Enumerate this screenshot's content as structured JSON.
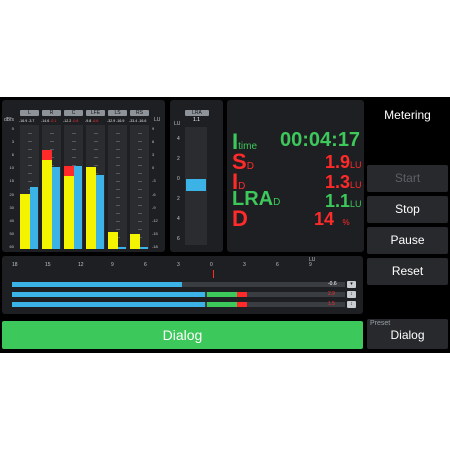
{
  "meter": {
    "unit_dbfs": "dBfs",
    "unit_lu": "LU",
    "channels": [
      {
        "name": "L",
        "v1": "-16.9",
        "v2": "-3.7",
        "v2_red": false,
        "level": 0.44,
        "peak": 0.44,
        "peak_red": false,
        "color": "#f4f400"
      },
      {
        "name": "R",
        "v1": "-14.6",
        "v2": "-0.1",
        "v2_red": true,
        "level": 0.72,
        "peak": 0.8,
        "peak_red": true,
        "color": "#f4f400"
      },
      {
        "name": "C",
        "v1": "-12.2",
        "v2": "-0.8",
        "v2_red": true,
        "level": 0.59,
        "peak": 0.8,
        "peak_red": true,
        "color": "#f4f400"
      },
      {
        "name": "LFE",
        "v1": "-9.8",
        "v2": "-6.6",
        "v2_red": true,
        "level": 0.66,
        "peak": 0.67,
        "peak_red": false,
        "color": "#f4f400"
      },
      {
        "name": "LS",
        "v1": "-32.9",
        "v2": "-16.9",
        "v2_red": false,
        "level": 0.14,
        "peak": 0.14,
        "peak_red": false,
        "color": "#f4f400"
      },
      {
        "name": "RS",
        "v1": "-33.4",
        "v2": "-16.6",
        "v2_red": false,
        "level": 0.12,
        "peak": 0.12,
        "peak_red": false,
        "color": "#f4f400"
      }
    ],
    "blue_levels": [
      0.5,
      0.66,
      0.67,
      0.6,
      0.02,
      0.01
    ],
    "db_scale": [
      "0",
      "3",
      "6",
      "10",
      "15",
      "20",
      "30",
      "40",
      "50",
      "60"
    ],
    "lu_scale": [
      "9",
      "6",
      "3",
      "0",
      "-3",
      "-6",
      "-9",
      "-12",
      "-15",
      "-18"
    ]
  },
  "lra": {
    "label": "LRA",
    "value": "1.1",
    "unit": "LU",
    "scale": [
      "4",
      "2",
      "0",
      "2",
      "4",
      "6"
    ],
    "level": 0.5
  },
  "readouts": {
    "itime_letter": "I",
    "itime_sub": "time",
    "itime_value": "00:04:17",
    "sd_letter": "S",
    "sd_sub": "D",
    "sd_value": "1.9",
    "sd_unit": "LU",
    "id_letter": "I",
    "id_sub": "D",
    "id_value": "1.3",
    "id_unit": "LU",
    "lra_letter": "LRA",
    "lra_sub": "D",
    "lra_value": "1.1",
    "lra_unit": "LU",
    "d_letter": "D",
    "d_value": "14",
    "d_unit": "%"
  },
  "sidebar": {
    "title": "Metering",
    "start": "Start",
    "stop": "Stop",
    "pause": "Pause",
    "reset": "Reset",
    "preset_label": "Preset",
    "preset_value": "Dialog"
  },
  "hbars": {
    "scale": [
      "18",
      "15",
      "12",
      "9",
      "6",
      "3",
      "0",
      "3",
      "6",
      "9"
    ],
    "unit": "LU",
    "rows": [
      {
        "value": "-0.6",
        "value_red": false,
        "level": 0.51,
        "green": 0.0,
        "red": 0.0
      },
      {
        "value": "2.9",
        "value_red": true,
        "level": 0.58,
        "green": 0.09,
        "red": 0.03
      },
      {
        "value": "1.5",
        "value_red": true,
        "level": 0.58,
        "green": 0.09,
        "red": 0.03
      }
    ],
    "buttons": [
      "▾",
      "↕",
      "↕"
    ]
  },
  "dialog_button": "Dialog",
  "colors": {
    "green": "#3cc85a",
    "red": "#ff2a2a",
    "blue": "#3bb3e6",
    "yellow": "#f4f400"
  }
}
